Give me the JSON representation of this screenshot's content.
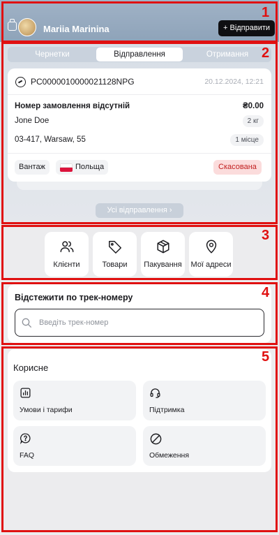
{
  "header": {
    "user_name": "Mariia Marinina",
    "send_button": "+ Відправити"
  },
  "tabs": [
    {
      "label": "Чернетки",
      "active": false
    },
    {
      "label": "Відправлення",
      "active": true
    },
    {
      "label": "Отримання",
      "active": false
    }
  ],
  "shipment": {
    "tracking_number": "PC0000010000021128NPG",
    "date": "20.12.2024, 12:21",
    "order_status": "Номер замовлення відсутній",
    "price": "₴0.00",
    "recipient": "Jone Doe",
    "weight": "2 кг",
    "address": "03-417, Warsaw, 55",
    "places": "1 місце",
    "cargo_type": "Вантаж",
    "country": "Польща",
    "status": "Скасована"
  },
  "all_shipments_button": "Усі відправлення",
  "quick_actions": [
    {
      "label": "Клієнти",
      "icon": "users-icon"
    },
    {
      "label": "Товари",
      "icon": "tag-icon"
    },
    {
      "label": "Пакування",
      "icon": "box-icon"
    },
    {
      "label": "Мої адреси",
      "icon": "location-pin-icon"
    }
  ],
  "tracking": {
    "title": "Відстежити по трек-номеру",
    "placeholder": "Введіть трек-номер",
    "value": ""
  },
  "useful": {
    "title": "Корисне",
    "items": [
      {
        "label": "Умови і тарифи",
        "icon": "chart-icon"
      },
      {
        "label": "Підтримка",
        "icon": "headset-icon"
      },
      {
        "label": "FAQ",
        "icon": "help-icon"
      },
      {
        "label": "Обмеження",
        "icon": "restriction-icon"
      }
    ]
  },
  "annotation_labels": [
    "1",
    "2",
    "3",
    "4",
    "5"
  ],
  "colors": {
    "accent": "#0f0f12",
    "header": "#97aabf",
    "cancel_bg": "#fbdcdc",
    "cancel_text": "#c11f1f",
    "annotation": "#e01010"
  }
}
